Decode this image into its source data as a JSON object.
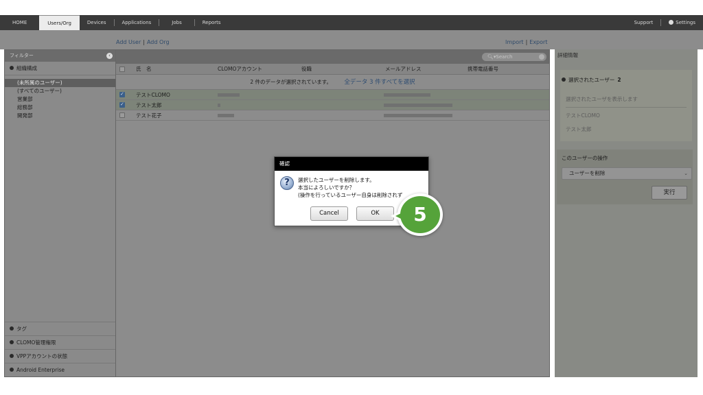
{
  "nav": {
    "tabs": [
      "HOME",
      "Users/Org",
      "Devices",
      "Applications",
      "Jobs",
      "Reports"
    ],
    "active_tab": "Users/Org",
    "support": "Support",
    "settings": "Settings"
  },
  "links": {
    "add_user": "Add User",
    "add_org": "Add Org",
    "import": "Import",
    "export": "Export",
    "separator": "|"
  },
  "filter": {
    "header": "フィルター",
    "org_section": "組織構成",
    "orgs": [
      "(未所属のユーザー)",
      "(すべてのユーザー)",
      "営業部",
      "総務部",
      "開発部"
    ],
    "selected_org": "(未所属のユーザー)",
    "bottom_sections": [
      "タグ",
      "CLOMO管理権限",
      "VPPアカウントの状態",
      "Android Enterprise"
    ]
  },
  "table": {
    "search_placeholder": "Search",
    "columns": [
      "氏　名",
      "CLOMOアカウント",
      "役職",
      "メールアドレス",
      "携帯電話番号"
    ],
    "selection_text": "2 件のデータが選択されています。",
    "select_all_link": "全データ 3 件すべてを選択",
    "rows": [
      {
        "name": "テストCLOMO",
        "checked": true
      },
      {
        "name": "テスト太郎",
        "checked": true
      },
      {
        "name": "テスト花子",
        "checked": false
      }
    ]
  },
  "details": {
    "header": "詳細情報",
    "selected_title": "選択されたユーザー",
    "selected_count": "2",
    "show_selected": "選択されたユーザを表示します",
    "selected_users": [
      "テストCLOMO",
      "テスト太郎"
    ],
    "ops_title": "このユーザーの操作",
    "ops_selected": "ユーザーを削除",
    "run_button": "実行"
  },
  "dialog": {
    "title": "確認",
    "line1": "選択したユーザーを削除します。",
    "line2": "本当によろしいですか？",
    "line3": "(操作を行っているユーザー自身は削除されず",
    "cancel": "Cancel",
    "ok": "OK"
  },
  "step_badge": "5",
  "colors": {
    "badge": "#55a33a",
    "nav_bg": "#3a3a3a",
    "dialog_title_bg": "#000000"
  }
}
